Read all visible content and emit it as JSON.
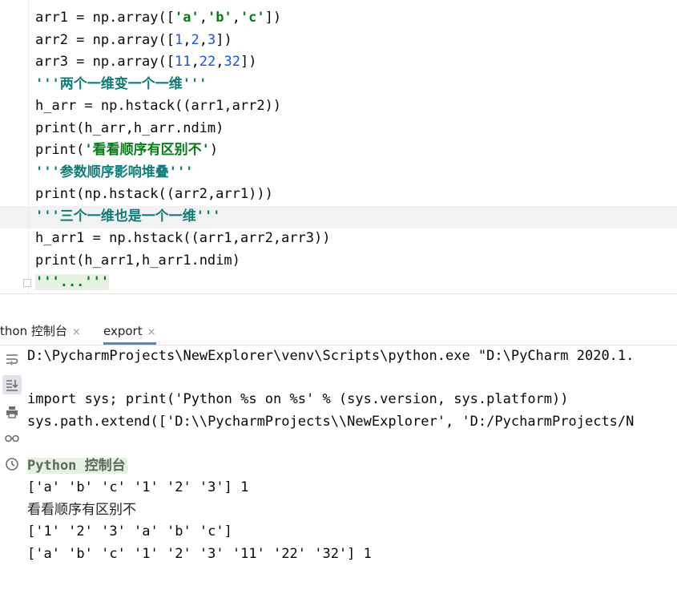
{
  "editor": {
    "lines": [
      {
        "parts": [
          {
            "t": "arr1 = np.array(["
          },
          {
            "t": "'a'",
            "c": "str"
          },
          {
            "t": ","
          },
          {
            "t": "'b'",
            "c": "str"
          },
          {
            "t": ","
          },
          {
            "t": "'c'",
            "c": "str"
          },
          {
            "t": "])"
          }
        ]
      },
      {
        "parts": [
          {
            "t": "arr2 = np.array(["
          },
          {
            "t": "1",
            "c": "num"
          },
          {
            "t": ","
          },
          {
            "t": "2",
            "c": "num"
          },
          {
            "t": ","
          },
          {
            "t": "3",
            "c": "num"
          },
          {
            "t": "])"
          }
        ]
      },
      {
        "parts": [
          {
            "t": "arr3 = np.array(["
          },
          {
            "t": "11",
            "c": "num"
          },
          {
            "t": ","
          },
          {
            "t": "22",
            "c": "num"
          },
          {
            "t": ","
          },
          {
            "t": "32",
            "c": "num"
          },
          {
            "t": "])"
          }
        ]
      },
      {
        "parts": [
          {
            "t": "'''两个一维变一个一维'''",
            "c": "doc"
          }
        ]
      },
      {
        "parts": [
          {
            "t": "h_arr = np.hstack((arr1,arr2))"
          }
        ]
      },
      {
        "parts": [
          {
            "t": "print(h_arr,h_arr.ndim)"
          }
        ]
      },
      {
        "parts": [
          {
            "t": "print("
          },
          {
            "t": "'看看顺序有区别不'",
            "c": "str"
          },
          {
            "t": ")"
          }
        ]
      },
      {
        "parts": [
          {
            "t": "'''参数顺序影响堆叠'''",
            "c": "doc"
          }
        ]
      },
      {
        "parts": [
          {
            "t": "print(np.hstack((arr2,arr1)))"
          }
        ]
      },
      {
        "parts": [
          {
            "t": "'''三个一维也是一个一维'''",
            "c": "doc"
          }
        ]
      },
      {
        "parts": [
          {
            "t": "h_arr1 = np.hstack((arr1,arr2,arr3))"
          }
        ]
      },
      {
        "parts": [
          {
            "t": "print(h_arr1,h_arr1.ndim)"
          }
        ]
      },
      {
        "parts": [
          {
            "t": "'''...'''",
            "c": "fold"
          }
        ]
      }
    ]
  },
  "tabs": [
    {
      "label": "thon 控制台",
      "close": "×"
    },
    {
      "label": "export",
      "close": "×"
    }
  ],
  "toolbar_icons": [
    "soft-wrap-icon",
    "scroll-to-end-icon",
    "print-icon",
    "glasses-icon",
    "history-icon"
  ],
  "console": {
    "lines": [
      "D:\\PycharmProjects\\NewExplorer\\venv\\Scripts\\python.exe \"D:\\PyCharm 2020.1.",
      "",
      "import sys; print('Python %s on %s' % (sys.version, sys.platform))",
      "sys.path.extend(['D:\\\\PycharmProjects\\\\NewExplorer', 'D:/PycharmProjects/N",
      "",
      "Python 控制台",
      "['a' 'b' 'c' '1' '2' '3'] 1",
      "看看顺序有区别不",
      "['1' '2' '3' 'a' 'b' 'c']",
      "['a' 'b' 'c' '1' '2' '3' '11' '22' '32'] 1"
    ]
  }
}
